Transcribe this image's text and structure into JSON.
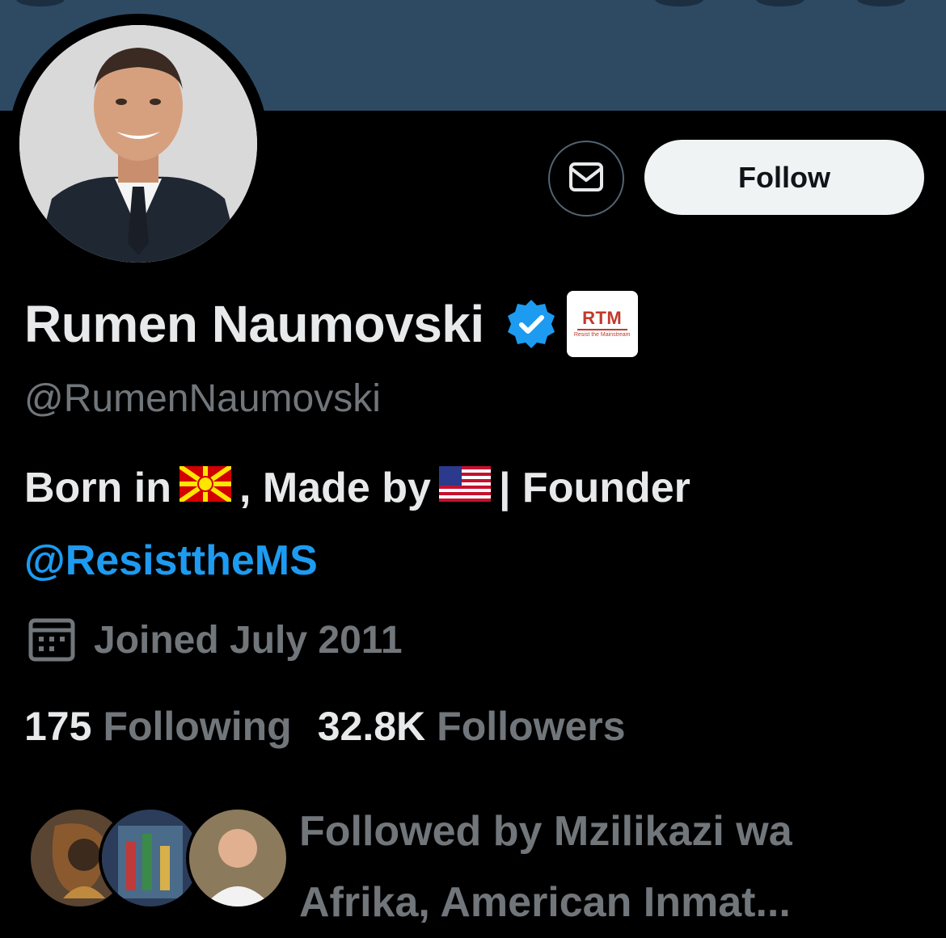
{
  "profile": {
    "display_name": "Rumen Naumovski",
    "handle": "@RumenNaumovski",
    "affiliate_badge": {
      "logo_text": "RTM",
      "subtitle": "Resist the Mainstream"
    },
    "bio": {
      "part1": "Born in",
      "part2": ", Made by",
      "part3": "| Founder",
      "link": "@ResisttheMS"
    },
    "joined": "Joined July 2011",
    "stats": {
      "following_count": "175",
      "following_label": "Following",
      "followers_count": "32.8K",
      "followers_label": "Followers"
    },
    "followed_by": "Followed by Mzilikazi wa Afrika, American Inmat..."
  },
  "actions": {
    "follow_label": "Follow"
  },
  "icons": {
    "message": "envelope-icon",
    "verified": "verified-badge-icon",
    "calendar": "calendar-icon"
  },
  "colors": {
    "background": "#000000",
    "banner": "#2e4a63",
    "link": "#1d9bf0",
    "verified": "#1d9bf0",
    "secondary_text": "#71767b",
    "follow_button": "#eff3f4"
  }
}
